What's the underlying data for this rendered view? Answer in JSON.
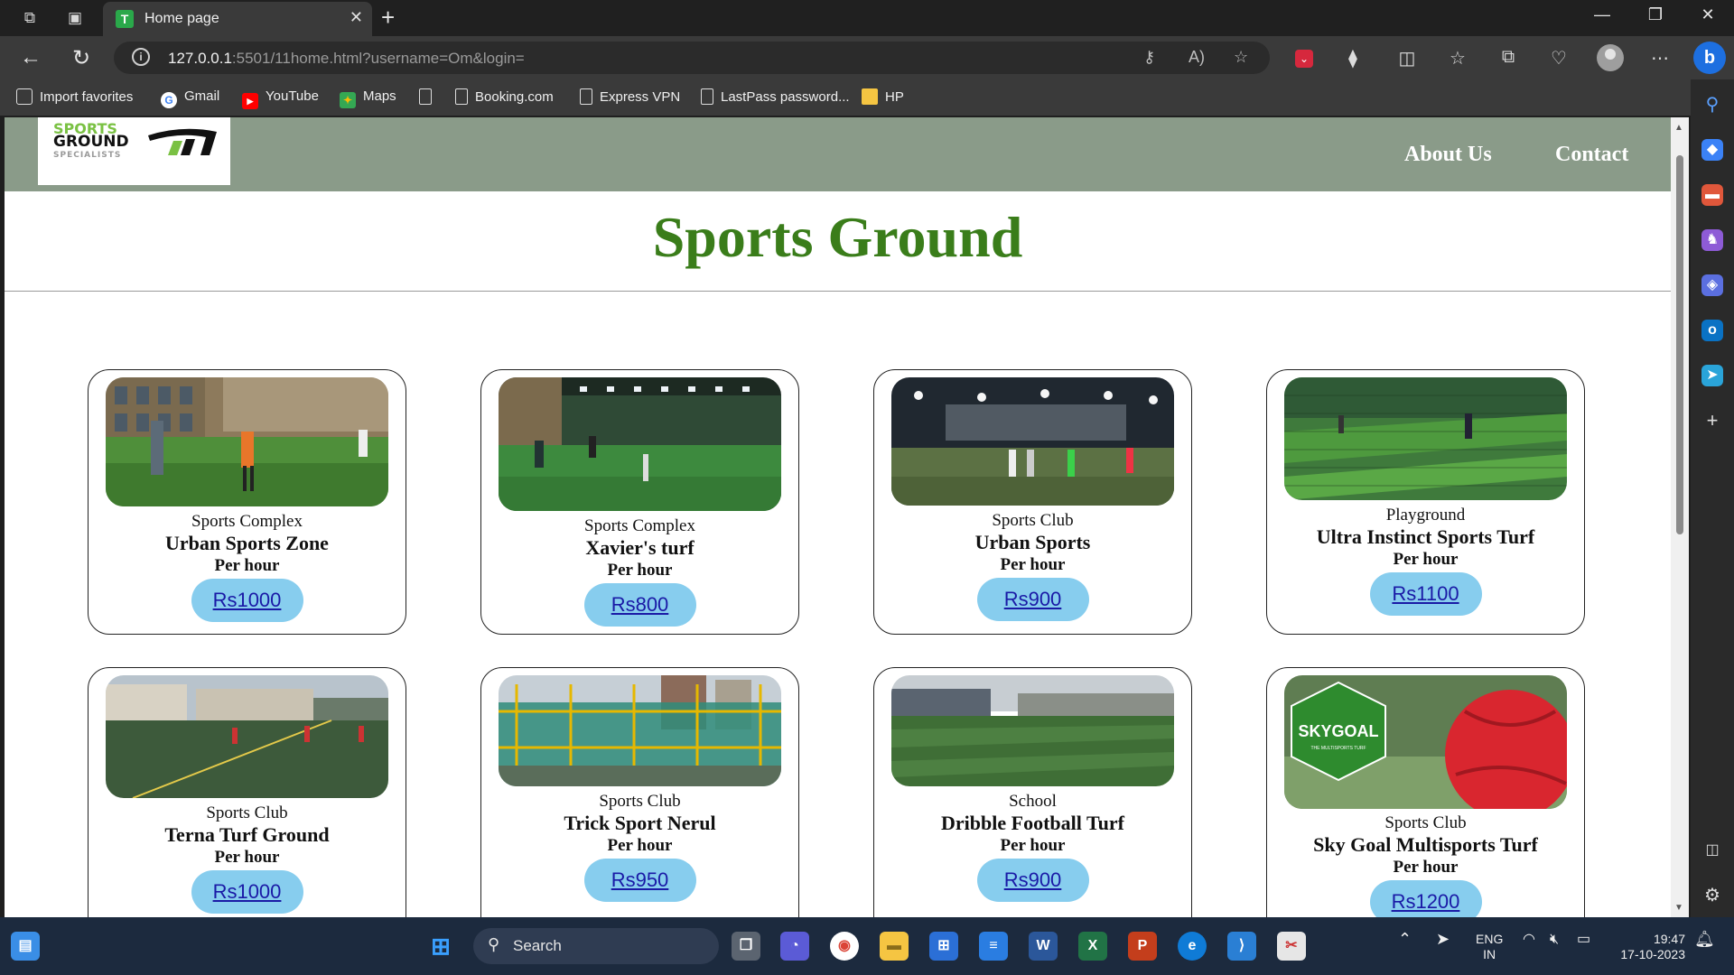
{
  "browser": {
    "tab_title": "Home page",
    "tab_favicon_letter": "T",
    "url_host": "127.0.0.1",
    "url_rest": ":5501/11home.html?username=Om&login=",
    "favorites": [
      {
        "label": "Import favorites"
      },
      {
        "label": "Gmail"
      },
      {
        "label": "YouTube"
      },
      {
        "label": "Maps"
      },
      {
        "label": ""
      },
      {
        "label": "Booking.com"
      },
      {
        "label": "Express VPN"
      },
      {
        "label": "LastPass password..."
      },
      {
        "label": "HP"
      }
    ]
  },
  "site": {
    "logo": {
      "line1": "SPORTS",
      "line2": "GROUND",
      "line3": "SPECIALISTS"
    },
    "nav": {
      "about": "About Us",
      "contact": "Contact"
    },
    "title": "Sports Ground",
    "colors": {
      "header_bg": "#8a9b89",
      "title": "#3a7d1a",
      "price_btn": "#87cdee"
    },
    "cards": [
      {
        "type": "Sports Complex",
        "name": "Urban Sports Zone",
        "per": "Per hour",
        "price": "Rs1000"
      },
      {
        "type": "Sports Complex",
        "name": "Xavier's turf",
        "per": "Per hour",
        "price": "Rs800"
      },
      {
        "type": "Sports Club",
        "name": "Urban Sports",
        "per": "Per hour",
        "price": "Rs900"
      },
      {
        "type": "Playground",
        "name": "Ultra Instinct Sports Turf",
        "per": "Per hour",
        "price": "Rs1100"
      },
      {
        "type": "Sports Club",
        "name": "Terna Turf Ground",
        "per": "Per hour",
        "price": "Rs1000"
      },
      {
        "type": "Sports Club",
        "name": "Trick Sport Nerul",
        "per": "Per hour",
        "price": "Rs950"
      },
      {
        "type": "School",
        "name": "Dribble Football Turf",
        "per": "Per hour",
        "price": "Rs900"
      },
      {
        "type": "Sports Club",
        "name": "Sky Goal Multisports Turf",
        "per": "Per hour",
        "price": "Rs1200"
      }
    ],
    "skygoal_logo": {
      "text": "SKYGOAL",
      "subtext": "THE MULTISPORTS TURF"
    }
  },
  "taskbar": {
    "search_label": "Search",
    "lang_line1": "ENG",
    "lang_line2": "IN",
    "time": "19:47",
    "date": "17-10-2023"
  }
}
